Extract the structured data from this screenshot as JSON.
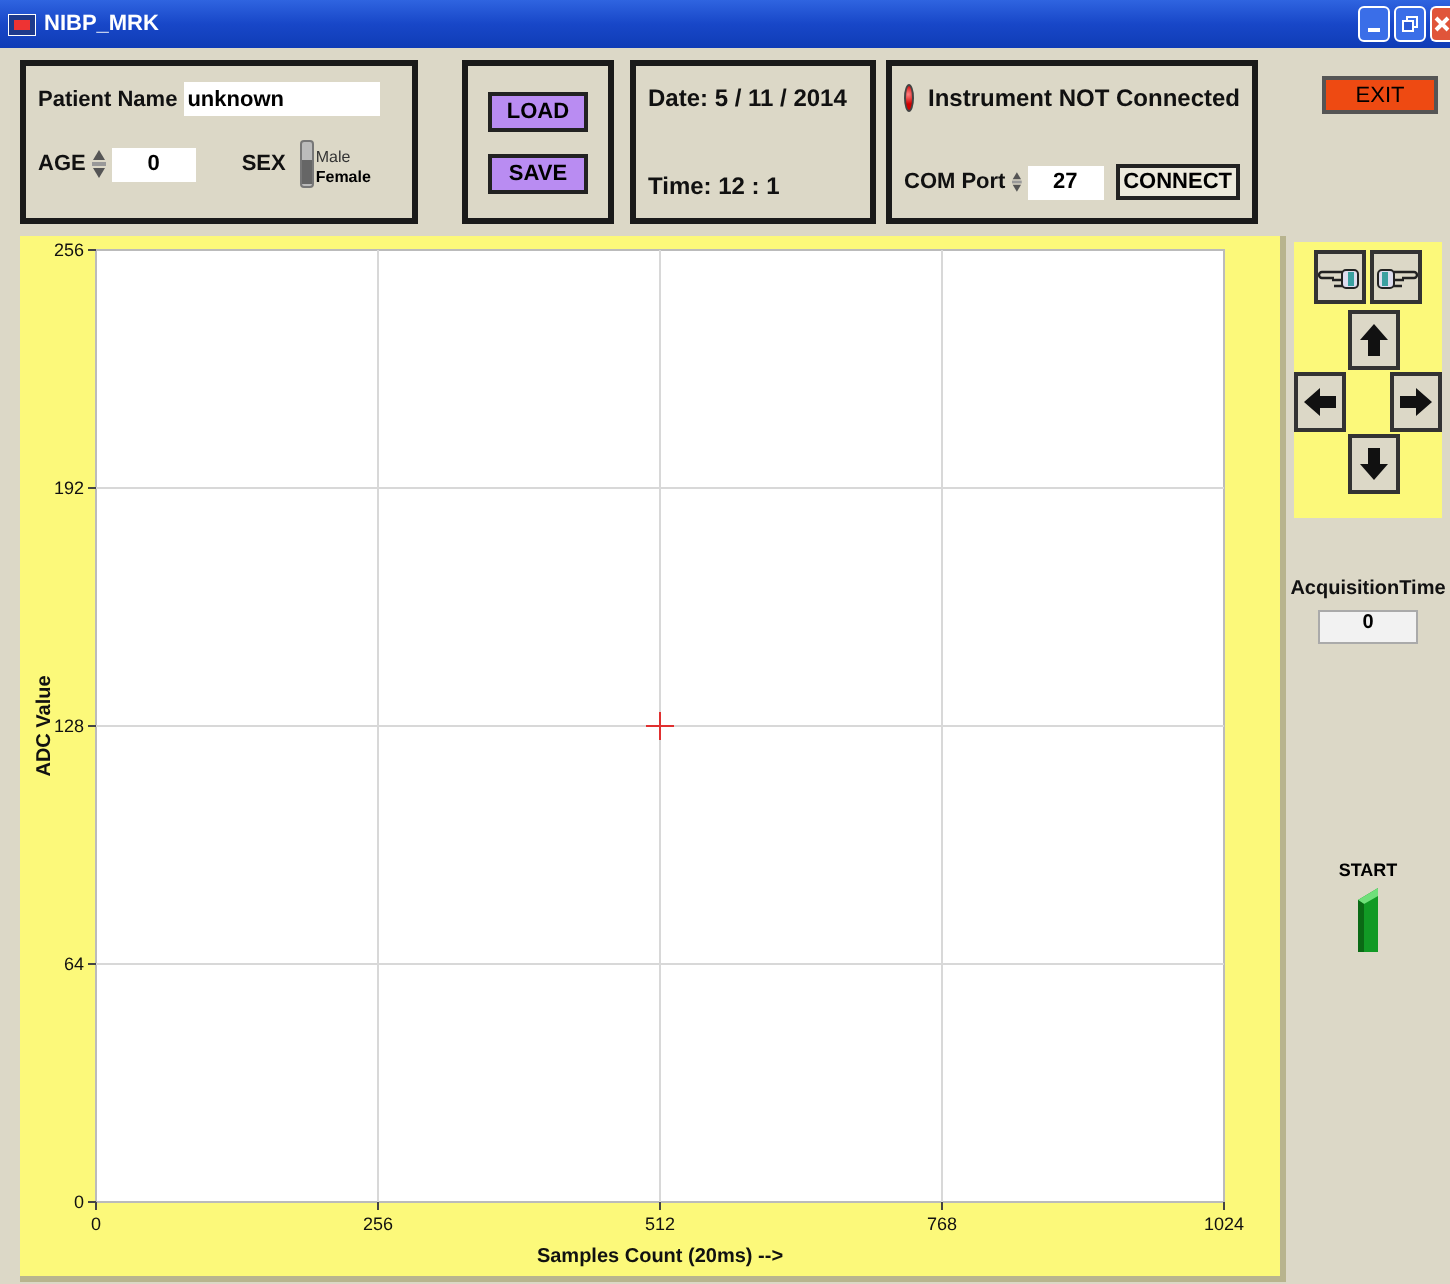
{
  "window": {
    "title": "NIBP_MRK"
  },
  "patient": {
    "name_label": "Patient Name",
    "name_value": "unknown",
    "age_label": "AGE",
    "age_value": "0",
    "sex_label": "SEX",
    "sex_options": [
      {
        "label": "Male",
        "selected": false
      },
      {
        "label": "Female",
        "selected": true
      }
    ]
  },
  "file_buttons": [
    "LOAD",
    "SAVE"
  ],
  "datetime": {
    "date": "Date: 5 / 11 / 2014",
    "time": "Time: 12 : 1"
  },
  "instrument": {
    "connected": false,
    "status": "Instrument NOT Connected",
    "port_label": "COM Port",
    "port_value": "27",
    "connect_button": "CONNECT"
  },
  "exit_button": "EXIT",
  "graph": {
    "cursor": {
      "visible": true
    },
    "chart_data": {
      "type": "line",
      "xlabel": "Samples Count (20ms) -->",
      "ylabel": "ADC Value",
      "xlim": [
        0,
        1024
      ],
      "ylim": [
        0,
        256
      ],
      "xticks": [
        0,
        256,
        512,
        768,
        1024
      ],
      "yticks": [
        0,
        64,
        128,
        192,
        256
      ],
      "grid": true
    }
  },
  "acquisition": {
    "label": "AcquisitionTime",
    "value": "0"
  },
  "start": {
    "label": "START",
    "on": false
  }
}
